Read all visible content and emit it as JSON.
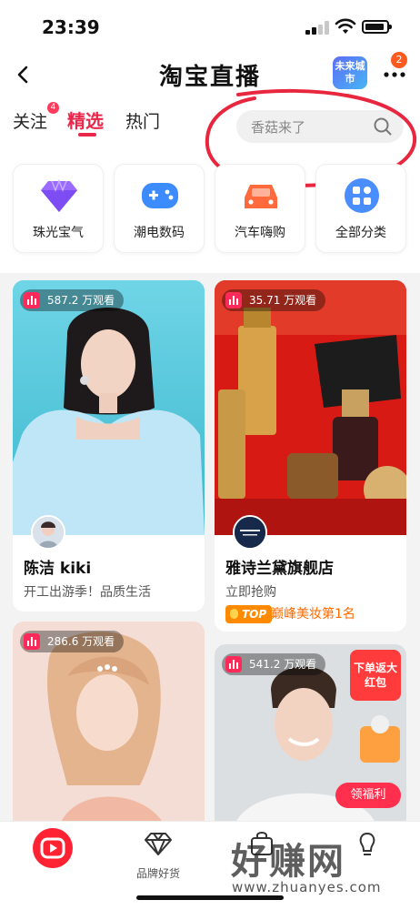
{
  "status_bar": {
    "time": "23:39"
  },
  "nav": {
    "title": "淘宝直播",
    "brand_logo_text": "未来城市",
    "notification_count": "2"
  },
  "tabs": [
    {
      "label": "关注",
      "badge": "4"
    },
    {
      "label": "精选",
      "active": true
    },
    {
      "label": "热门"
    }
  ],
  "search": {
    "placeholder": "香菇来了"
  },
  "categories": [
    {
      "label": "珠光宝气",
      "icon": "diamond-icon",
      "color": "#9b6bff"
    },
    {
      "label": "潮电数码",
      "icon": "gamepad-icon",
      "color": "#3d8cff"
    },
    {
      "label": "汽车嗨购",
      "icon": "car-icon",
      "color": "#ff6a3d"
    },
    {
      "label": "全部分类",
      "icon": "grid-icon",
      "color": "#4a8dff"
    }
  ],
  "feed": [
    {
      "viewers": "587.2 万观看",
      "title": "陈洁 kiki",
      "subtitle": "开工出游季！品质生活"
    },
    {
      "viewers": "35.71 万观看",
      "title": "雅诗兰黛旗舰店",
      "subtitle": "立即抢购",
      "badge": "TOP",
      "rank_text": "巅峰美妆第1名"
    },
    {
      "viewers": "286.6 万观看"
    },
    {
      "viewers": "541.2 万观看",
      "promo": "下单返大红包",
      "benefit": "领福利"
    }
  ],
  "bottom_nav": [
    {
      "label": "",
      "icon": "live-home-icon"
    },
    {
      "label": "品牌好货",
      "icon": "diamond-outline-icon"
    },
    {
      "label": "",
      "icon": "bag-icon"
    },
    {
      "label": "",
      "icon": "lightbulb-icon"
    }
  ],
  "watermark": {
    "text": "好赚网",
    "url": "www.zhuanyes.com"
  },
  "colors": {
    "accent": "#e8274b",
    "annotation": "#e8273f"
  }
}
